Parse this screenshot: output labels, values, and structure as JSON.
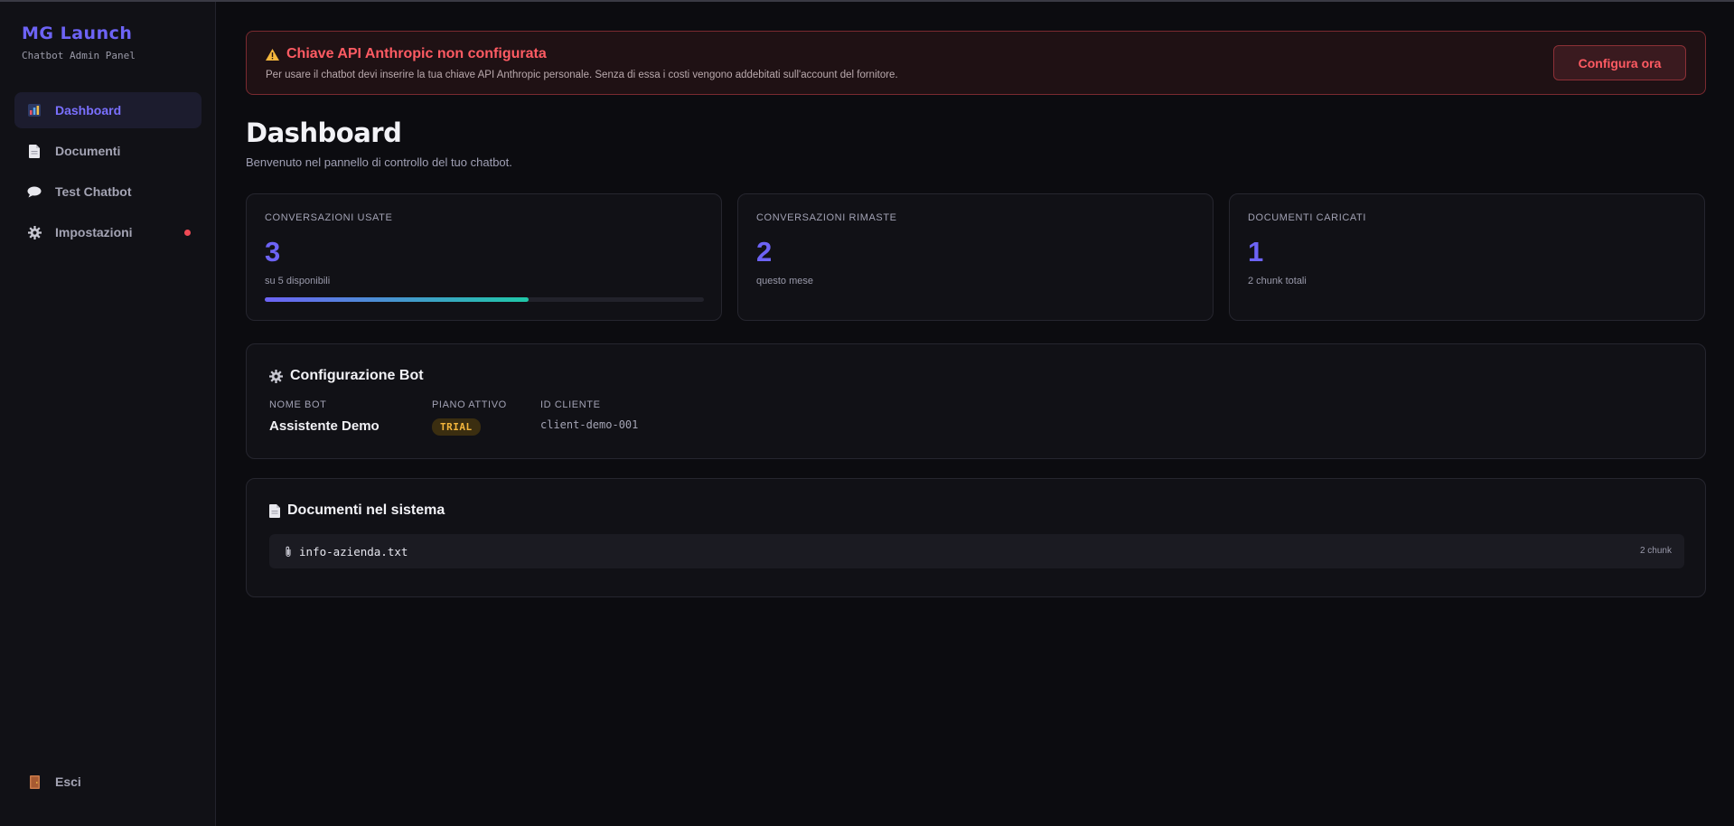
{
  "brand": {
    "title": "MG Launch",
    "subtitle": "Chatbot Admin Panel"
  },
  "nav": {
    "items": [
      {
        "label": "Dashboard",
        "icon": "bar-chart-icon",
        "active": true
      },
      {
        "label": "Documenti",
        "icon": "document-icon"
      },
      {
        "label": "Test Chatbot",
        "icon": "speech-bubble-icon"
      },
      {
        "label": "Impostazioni",
        "icon": "gear-icon",
        "notification": true
      }
    ],
    "logout": {
      "label": "Esci",
      "icon": "door-icon"
    }
  },
  "alert": {
    "title": "Chiave API Anthropic non configurata",
    "text": "Per usare il chatbot devi inserire la tua chiave API Anthropic personale. Senza di essa i costi vengono addebitati sull'account del fornitore.",
    "button": "Configura ora",
    "icon": "warning-icon"
  },
  "page": {
    "title": "Dashboard",
    "subtitle": "Benvenuto nel pannello di controllo del tuo chatbot."
  },
  "stats": [
    {
      "label": "CONVERSAZIONI USATE",
      "value": "3",
      "sub": "su 5 disponibili",
      "progress": 0.6
    },
    {
      "label": "CONVERSAZIONI RIMASTE",
      "value": "2",
      "sub": "questo mese"
    },
    {
      "label": "DOCUMENTI CARICATI",
      "value": "1",
      "sub": "2 chunk totali"
    }
  ],
  "config": {
    "title": "Configurazione Bot",
    "icon": "gear-icon",
    "bot_name_label": "NOME BOT",
    "bot_name": "Assistente Demo",
    "plan_label": "PIANO ATTIVO",
    "plan": "TRIAL",
    "client_id_label": "ID CLIENTE",
    "client_id": "client-demo-001"
  },
  "documents": {
    "title": "Documenti nel sistema",
    "icon": "document-icon",
    "items": [
      {
        "name": "info-azienda.txt",
        "chunks": "2 chunk",
        "icon": "paperclip-icon"
      }
    ]
  },
  "colors": {
    "accent": "#6d63f5",
    "danger": "#ff5b63",
    "warning_badge": "#f4b63c",
    "progress_end": "#1fc8a8"
  }
}
